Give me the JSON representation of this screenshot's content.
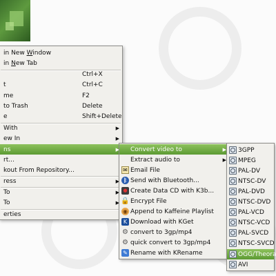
{
  "menu1": {
    "items": [
      {
        "label_pre": "in New ",
        "label_u": "W",
        "label_post": "indow"
      },
      {
        "label_pre": "in ",
        "label_u": "N",
        "label_post": "ew Tab"
      },
      {
        "label": "",
        "shortcut": "Ctrl+X"
      },
      {
        "label": "t",
        "shortcut": "Ctrl+C"
      },
      {
        "label": "me",
        "shortcut": "F2"
      },
      {
        "label": "to Trash",
        "shortcut": "Delete"
      },
      {
        "label": "e",
        "shortcut": "Shift+Delete"
      },
      {
        "label": "With"
      },
      {
        "label": "ew In"
      },
      {
        "label": "ns"
      },
      {
        "label": "rt..."
      },
      {
        "label": "kout From Repository..."
      },
      {
        "label": "ress"
      },
      {
        "label": "To"
      },
      {
        "label": "To"
      },
      {
        "label": "erties"
      }
    ]
  },
  "menu2": {
    "items": [
      {
        "label": "Convert video to"
      },
      {
        "label": "Extract audio to"
      },
      {
        "label": "Email File"
      },
      {
        "label": "Send with Bluetooth..."
      },
      {
        "label": "Create Data CD with K3b..."
      },
      {
        "label": "Encrypt File"
      },
      {
        "label": "Append to Kaffeine Playlist"
      },
      {
        "label": "Download with KGet"
      },
      {
        "label": "convert to 3gp/mp4"
      },
      {
        "label": "quick convert to 3gp/mp4"
      },
      {
        "label": "Rename with KRename"
      }
    ]
  },
  "menu3": {
    "items": [
      "3GPP",
      "MPEG",
      "PAL-DV",
      "NTSC-DV",
      "PAL-DVD",
      "NTSC-DVD",
      "PAL-VCD",
      "NTSC-VCD",
      "PAL-SVCD",
      "NTSC-SVCD",
      "OGG/Theora",
      "AVI"
    ]
  },
  "arrow": "▶",
  "colors": {
    "highlight": "#6da540",
    "menu_bg": "#f1f0ec"
  }
}
